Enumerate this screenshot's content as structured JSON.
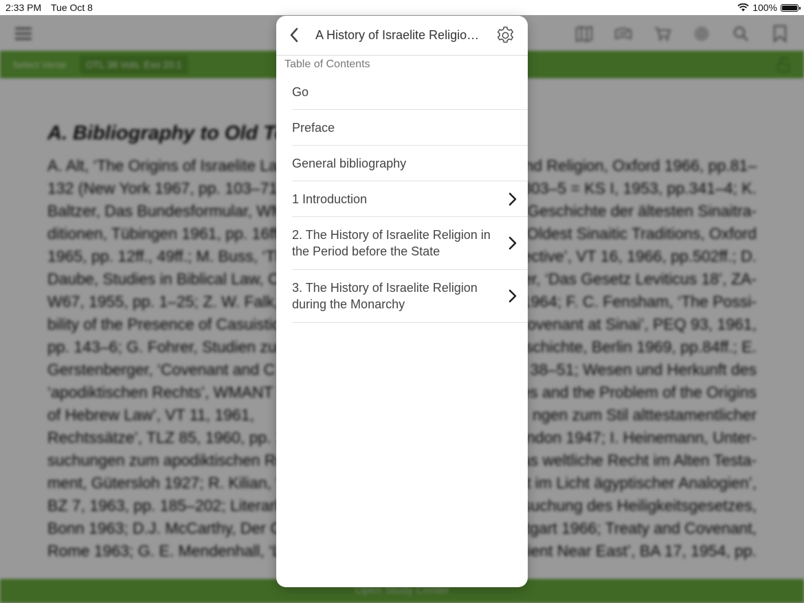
{
  "status_bar": {
    "time": "2:33 PM",
    "date": "Tue Oct 8",
    "battery": "100%",
    "battery_level": 1.0
  },
  "toolbar": {
    "icons": [
      "menu-icon",
      "map-icon",
      "library-icon",
      "cart-icon",
      "gear-icon",
      "search-icon",
      "bookmark-icon"
    ]
  },
  "verse_bar": {
    "select_label": "Select Verse",
    "reference": "OTL 38 Vols. Exo 20:1"
  },
  "document": {
    "heading": "A. Bibliography to Old Test",
    "paragraph_lines": [
      "A. Alt, ‘The Origins of Israelite La",
      "132 (New York 1967, pp. 103–71);",
      "Baltzer, Das Bundesformular, WM",
      "ditionen, Tübingen 1961, pp. 16ff",
      "1965, pp. 12ff., 49ff.; M. Buss, ‘The",
      "Daube, Studies in Biblical Law, Ca",
      "W67, 1955, pp. 1–25; Z. W. Falk, H",
      "bility of the Presence of Casuistic",
      "pp. 143–6; G. Fohrer, Studien zur",
      "Gerstenberger, ‘Covenant and C",
      "‘apodiktischen Rechts’, WMANT 20",
      "of Hebrew Law’, VT 11, 1961,",
      "Rechtssätze’, TLZ 85, 1960, pp. 14",
      "suchungen zum apodiktischen Re",
      "ment, Gütersloh 1927; R. Kilian, ‘A",
      "BZ 7, 1963, pp. 185–202; Literark",
      "Bonn 1963; D.J. McCarthy, Der G",
      "Rome 1963; G. E. Mendenhall, ‘La"
    ],
    "right_lines": [
      "and Religion, Oxford 1966, pp.81–",
      "p.303–5 = KS I, 1953, pp.341–4; K.",
      "d Geschichte der ältesten Sinaitra-",
      "Oldest Sinaitic Traditions, Oxford",
      "spective’, VT 16, 1966, pp.502ff.; D.",
      "ger, ‘Das Gesetz Leviticus 18’, ZA-",
      "m 1964; F. C. Fensham, ‘The Possi-",
      "Covenant at Sinai’, PEQ 93, 1961,",
      "eschichte, Berlin 1969, pp.84ff.; E.",
      "38–51; Wesen und Herkunft des",
      "es and the Problem of the Origins",
      "ngen zum Stil alttestamentlicher",
      "London 1947; I. Heinemann, Unter-",
      "Das weltliche Recht im Alten Testa-",
      "t im Licht ägyptischer Analogien’,",
      "ersuchung des Heiligkeitsgesetzes,",
      "ttgart 1966; Treaty and Covenant,",
      "ncient Near East’, BA 17, 1954, pp."
    ]
  },
  "study_bar": {
    "label": "Open Study Center"
  },
  "popover": {
    "title": "A History of Israelite Religion in the Old Testament Period",
    "section_label": "Table of Contents",
    "items": [
      {
        "label": "Go",
        "has_children": false
      },
      {
        "label": "Preface",
        "has_children": false
      },
      {
        "label": "General bibliography",
        "has_children": false
      },
      {
        "label": "1 Introduction",
        "has_children": true
      },
      {
        "label": "2. The History of Israelite Religion in the Period before the State",
        "has_children": true
      },
      {
        "label": "3. The History of Israelite Religion during the Monarchy",
        "has_children": true
      }
    ]
  },
  "colors": {
    "accent_green": "#6aaf3d",
    "link_green": "#4fa22c"
  }
}
